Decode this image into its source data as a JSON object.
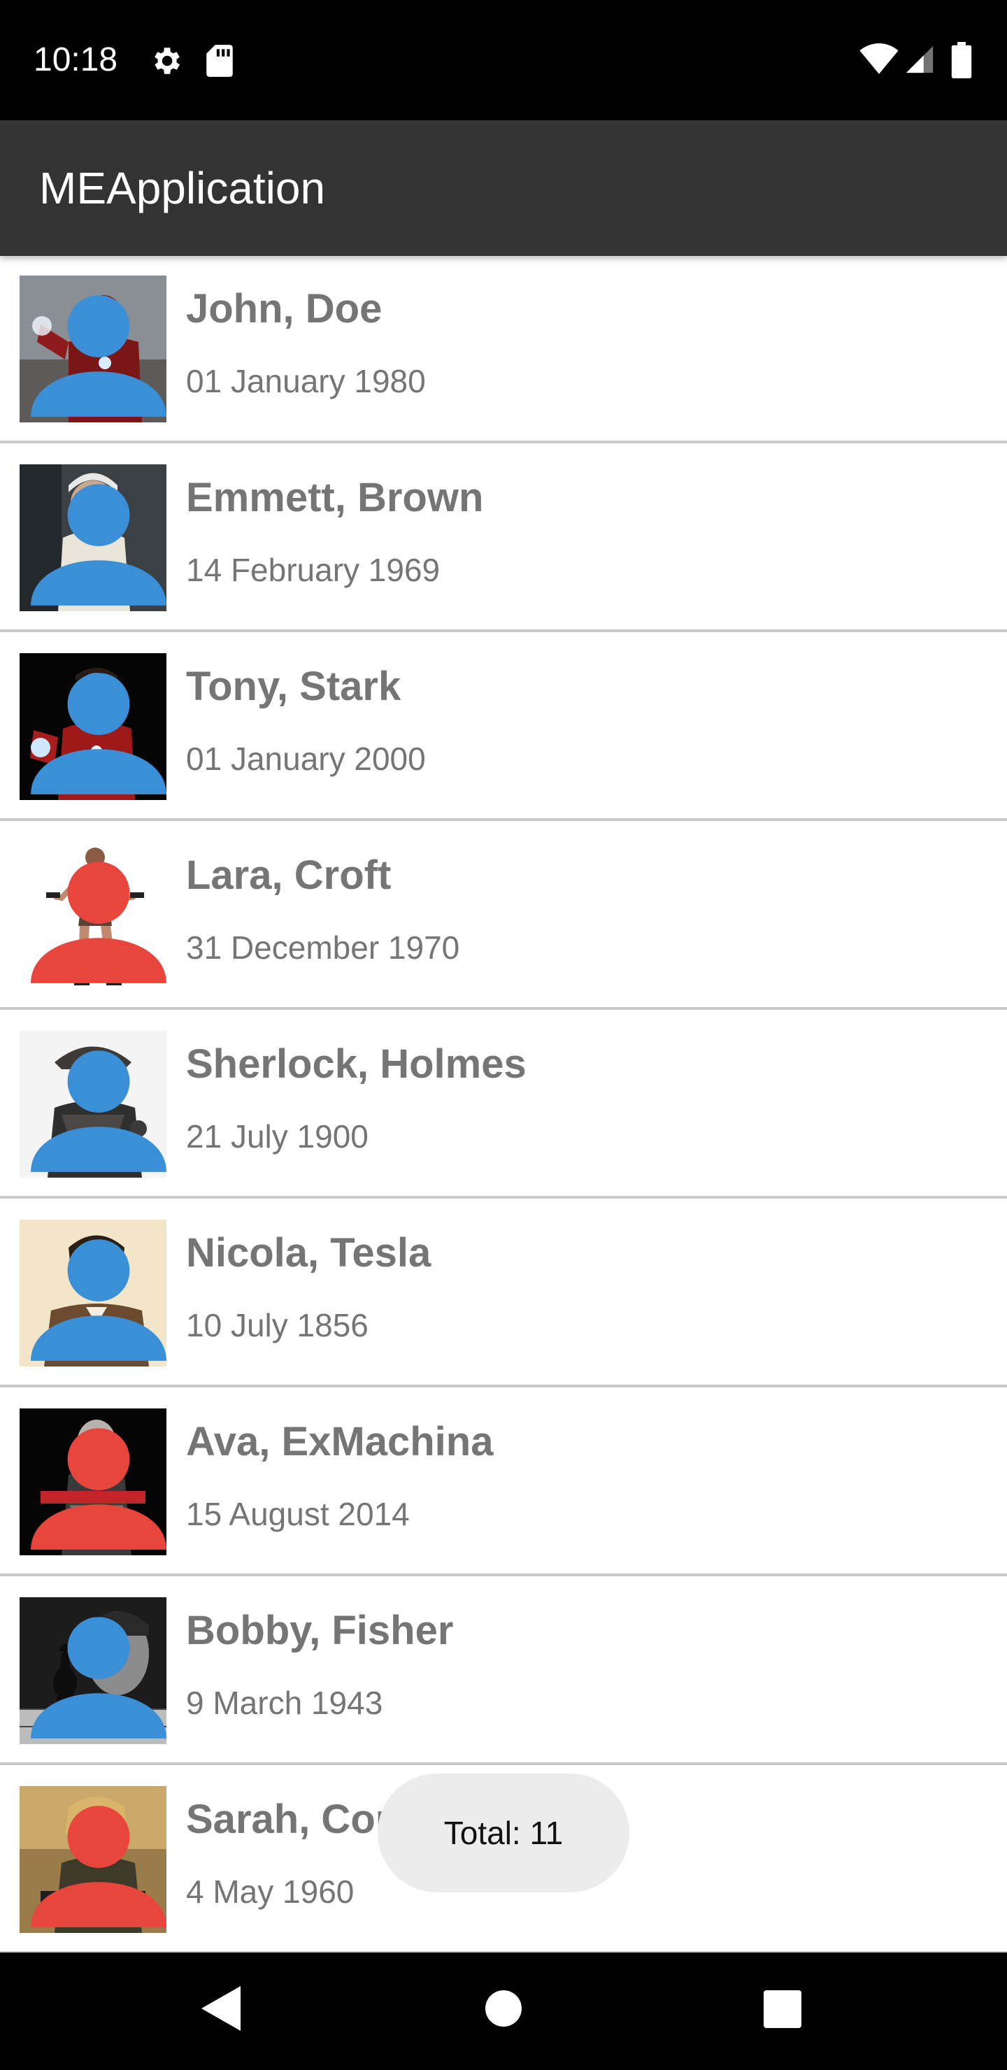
{
  "status_bar": {
    "time": "10:18",
    "icons": [
      "gear-icon",
      "sd-card-icon",
      "wifi-icon",
      "cell-signal-icon",
      "battery-icon"
    ]
  },
  "app_bar": {
    "title": "MEApplication"
  },
  "colors": {
    "male": "#3a8fd6",
    "female": "#e8453c",
    "text": "#757575",
    "app_bar": "#333333"
  },
  "people": [
    {
      "name": "John, Doe",
      "date": "01 January 1980",
      "gender": "male",
      "icon": "person-icon"
    },
    {
      "name": "Emmett, Brown",
      "date": "14 February 1969",
      "gender": "male",
      "icon": "person-icon"
    },
    {
      "name": "Tony, Stark",
      "date": "01 January 2000",
      "gender": "male",
      "icon": "person-icon"
    },
    {
      "name": "Lara, Croft",
      "date": "31 December 1970",
      "gender": "female",
      "icon": "person-icon"
    },
    {
      "name": "Sherlock, Holmes",
      "date": "21 July 1900",
      "gender": "male",
      "icon": "person-icon"
    },
    {
      "name": "Nicola, Tesla",
      "date": "10 July 1856",
      "gender": "male",
      "icon": "person-icon"
    },
    {
      "name": "Ava, ExMachina",
      "date": "15 August 2014",
      "gender": "female",
      "icon": "person-icon"
    },
    {
      "name": "Bobby, Fisher",
      "date": "9 March 1943",
      "gender": "male",
      "icon": "person-icon"
    },
    {
      "name": "Sarah, Corner",
      "date": "4 May 1960",
      "gender": "female",
      "icon": "person-icon"
    }
  ],
  "toast": {
    "text": "Total: 11"
  },
  "nav_bar": {
    "icons": [
      "back-icon",
      "home-icon",
      "recents-icon"
    ]
  }
}
